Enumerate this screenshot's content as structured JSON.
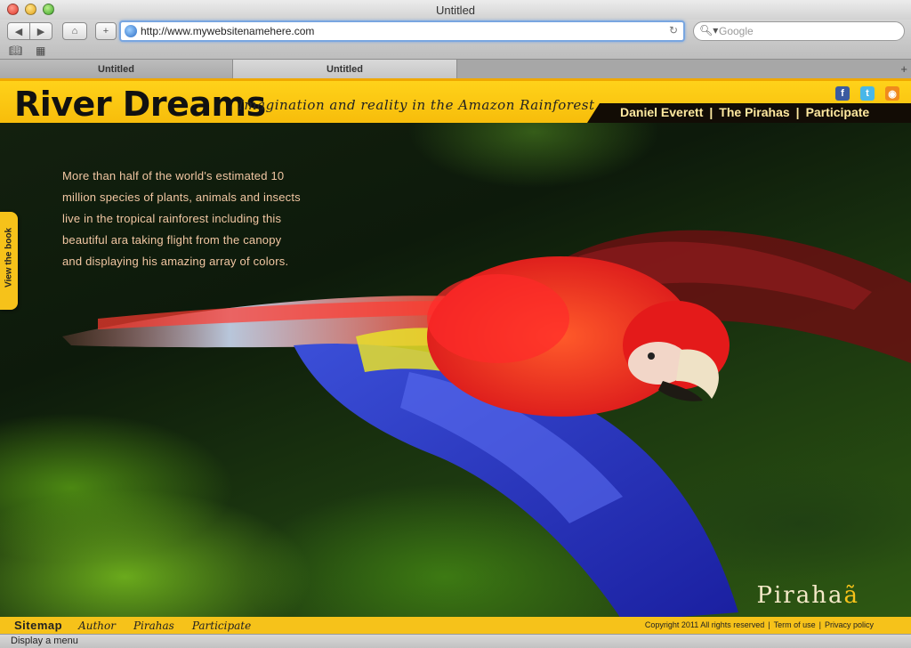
{
  "window": {
    "title": "Untitled"
  },
  "toolbar": {
    "url": "http://www.mywebsitenamehere.com",
    "search_placeholder": "Google"
  },
  "tabs": [
    {
      "label": "Untitled"
    },
    {
      "label": "Untitled"
    }
  ],
  "site": {
    "title": "River Dreams",
    "tagline": "Imagination and reality in the Amazon Rainforest",
    "nav": [
      "Daniel Everett",
      "The Pirahas",
      "Participate"
    ],
    "nav_separator": "|",
    "social": [
      "facebook-icon",
      "twitter-icon",
      "rss-icon"
    ],
    "intro": "More than half of the world's estimated 10 million species of plants, animals and insects live in the tropical rainforest including this beautiful ara taking flight from the canopy and displaying his amazing array of colors.",
    "view_book": "View the book",
    "brand_mark": "Piraha",
    "brand_mark_accent": "ã"
  },
  "footer": {
    "sitemap": "Sitemap",
    "links": [
      "Author",
      "Pirahas",
      "Participate"
    ],
    "copyright": "Copyright 2011 All rights reserved",
    "terms": "Term of use",
    "privacy": "Privacy policy",
    "separator": "|"
  },
  "status": {
    "text": "Display a menu"
  },
  "colors": {
    "accent": "#f6c21a",
    "nav_bg": "#120c05",
    "intro_text": "#f2c7a3"
  }
}
